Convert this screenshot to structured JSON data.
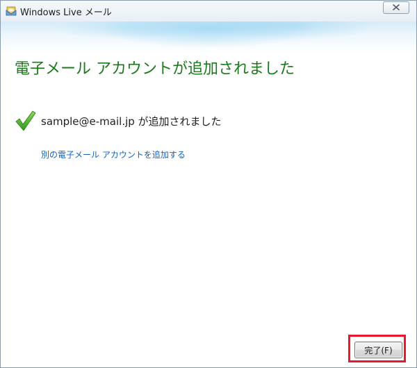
{
  "window": {
    "title": "Windows Live メール",
    "close_icon": "close-icon",
    "app_icon": "windows-live-mail-icon"
  },
  "content": {
    "heading": "電子メール アカウントが追加されました",
    "status_icon": "checkmark-icon",
    "status_message": "sample@e-mail.jp が追加されました",
    "add_another_link": "別の電子メール アカウントを追加する"
  },
  "footer": {
    "finish_button_label": "完了(F)"
  },
  "colors": {
    "heading_green": "#1a7a1a",
    "link_blue": "#1463b8",
    "highlight_red": "#e8192c",
    "check_green": "#4caf2a"
  }
}
